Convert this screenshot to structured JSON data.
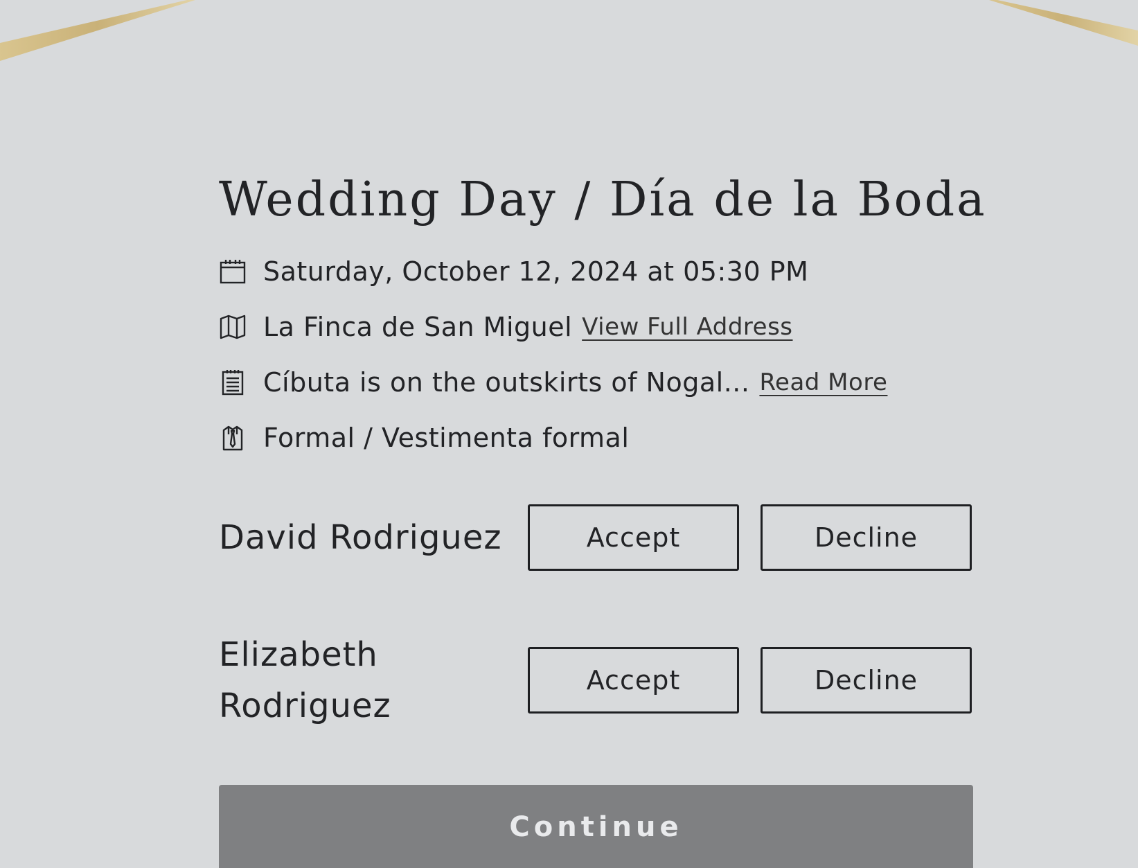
{
  "event": {
    "title": "Wedding Day / Día de la Boda",
    "datetime": "Saturday, October 12, 2024 at 05:30 PM",
    "venue": "La Finca de San Miguel",
    "venue_link": "View Full Address",
    "description": "Cíbuta is on the outskirts of Nogal...",
    "description_link": "Read More",
    "dress_code": "Formal / Vestimenta formal"
  },
  "guests": [
    {
      "name": "David Rodriguez",
      "accept_label": "Accept",
      "decline_label": "Decline"
    },
    {
      "name": "Elizabeth Rodriguez",
      "accept_label": "Accept",
      "decline_label": "Decline"
    }
  ],
  "continue_label": "Continue",
  "colors": {
    "background": "#d8dadc",
    "text": "#222326",
    "gold_accent": "#c9b178",
    "continue_button": "#7f8082"
  },
  "icons": {
    "date": "calendar-icon",
    "venue": "map-icon",
    "description": "notepad-icon",
    "dress_code": "shirt-tie-icon"
  }
}
